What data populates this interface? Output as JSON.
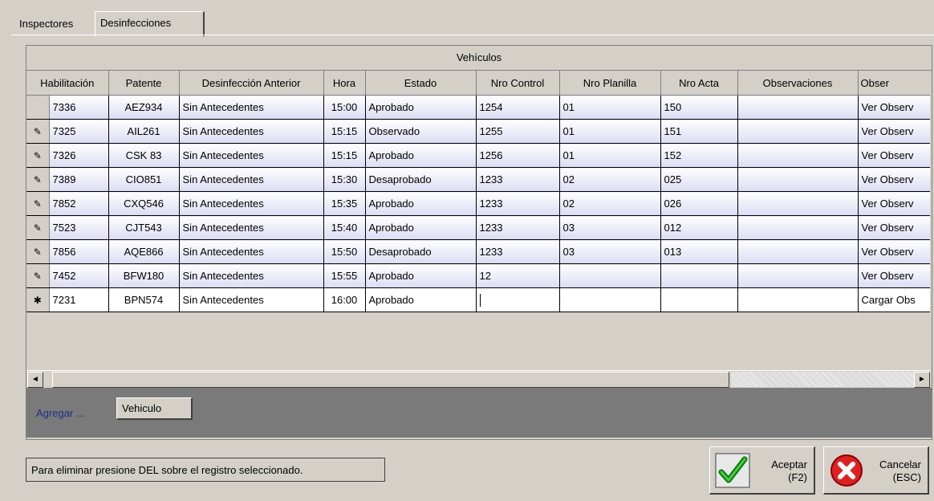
{
  "tabs": {
    "inspectores": "Inspectores",
    "desinfecciones": "Desinfecciones"
  },
  "grid": {
    "caption": "Vehículos",
    "columns": [
      "Habilitación",
      "Patente",
      "Desinfección Anterior",
      "Hora",
      "Estado",
      "Nro Control",
      "Nro Planilla",
      "Nro Acta",
      "Observaciones",
      "Obser"
    ],
    "rows": [
      {
        "ind": "",
        "hab": "7336",
        "pat": "AEZ934",
        "ant": "Sin Antecedentes",
        "hora": "15:00",
        "estado": "Aprobado",
        "control": "1254",
        "planilla": "01",
        "acta": "150",
        "obs": "",
        "obs2": "Ver Observ"
      },
      {
        "ind": "✎",
        "hab": "7325",
        "pat": "AIL261",
        "ant": "Sin Antecedentes",
        "hora": "15:15",
        "estado": "Observado",
        "control": "1255",
        "planilla": "01",
        "acta": "151",
        "obs": "",
        "obs2": "Ver Observ"
      },
      {
        "ind": "✎",
        "hab": "7326",
        "pat": "CSK 83",
        "ant": "Sin Antecedentes",
        "hora": "15:15",
        "estado": "Aprobado",
        "control": "1256",
        "planilla": "01",
        "acta": "152",
        "obs": "",
        "obs2": "Ver Observ"
      },
      {
        "ind": "✎",
        "hab": "7389",
        "pat": "CIO851",
        "ant": "Sin Antecedentes",
        "hora": "15:30",
        "estado": "Desaprobado",
        "control": "1233",
        "planilla": "02",
        "acta": "025",
        "obs": "",
        "obs2": "Ver Observ"
      },
      {
        "ind": "✎",
        "hab": "7852",
        "pat": "CXQ546",
        "ant": "Sin Antecedentes",
        "hora": "15:35",
        "estado": "Aprobado",
        "control": "1233",
        "planilla": "02",
        "acta": "026",
        "obs": "",
        "obs2": "Ver Observ"
      },
      {
        "ind": "✎",
        "hab": "7523",
        "pat": "CJT543",
        "ant": "Sin Antecedentes",
        "hora": "15:40",
        "estado": "Aprobado",
        "control": "1233",
        "planilla": "03",
        "acta": "012",
        "obs": "",
        "obs2": "Ver Observ"
      },
      {
        "ind": "✎",
        "hab": "7856",
        "pat": "AQE866",
        "ant": "Sin Antecedentes",
        "hora": "15:50",
        "estado": "Desaprobado",
        "control": "1233",
        "planilla": "03",
        "acta": "013",
        "obs": "",
        "obs2": "Ver Observ"
      },
      {
        "ind": "✎",
        "hab": "7452",
        "pat": "BFW180",
        "ant": "Sin Antecedentes",
        "hora": "15:55",
        "estado": "Aprobado",
        "control": "12",
        "planilla": "",
        "acta": "",
        "obs": "",
        "obs2": "Ver Observ"
      },
      {
        "ind": "✱",
        "hab": "7231",
        "pat": "BPN574",
        "ant": "Sin Antecedentes",
        "hora": "16:00",
        "estado": "Aprobado",
        "control": "",
        "planilla": "",
        "acta": "",
        "obs": "",
        "obs2": "Cargar Obs"
      }
    ]
  },
  "addbar": {
    "label": "Agregar ...",
    "vehiculo_button": "Vehiculo"
  },
  "status_text": "Para eliminar presione DEL sobre el registro seleccionado.",
  "buttons": {
    "aceptar": {
      "line1": "Aceptar",
      "line2": "(F2)",
      "icon": "green-check-icon"
    },
    "cancelar": {
      "line1": "Cancelar",
      "line2": "(ESC)",
      "icon": "red-x-icon"
    }
  },
  "scrollbar": {
    "left_icon": "◄",
    "right_icon": "►"
  },
  "colors": {
    "face": "#d4d0c8",
    "addbar_bg": "#7a7a7a",
    "addbar_label": "#1c2e8a",
    "row_gradient_end": "#dcdcf4"
  }
}
